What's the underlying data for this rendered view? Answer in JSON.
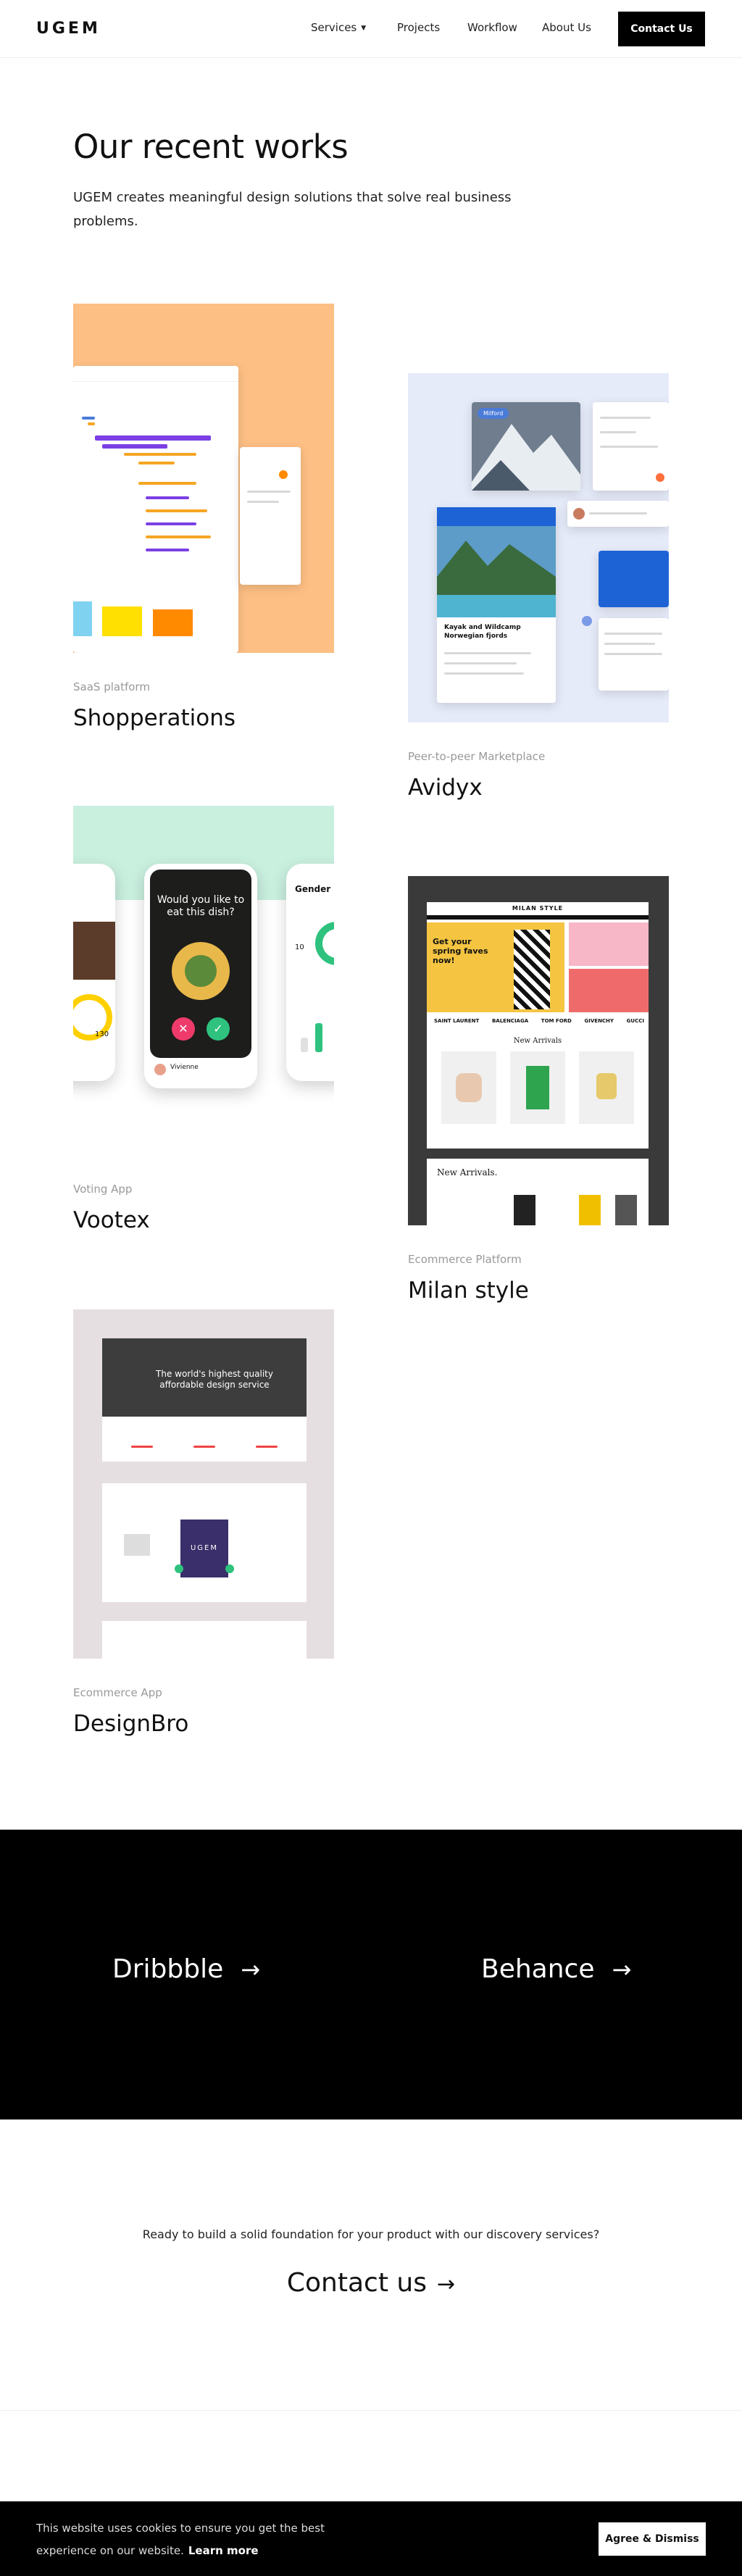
{
  "header": {
    "logo": "UGEM",
    "nav": [
      "Services",
      "Projects",
      "Workflow",
      "About Us"
    ],
    "cta": "Contact Us"
  },
  "hero": {
    "title": "Our recent works",
    "subtitle": "UGEM creates meaningful design solutions that solve real business problems."
  },
  "projects": [
    {
      "category": "SaaS platform",
      "title": "Shopperations",
      "bg": "#fdbf84"
    },
    {
      "category": "Peer-to-peer Marketplace",
      "title": "Avidyx",
      "bg": "#e6ebf9"
    },
    {
      "category": "Voting App",
      "title": "Vootex",
      "bg": "#c9efdf"
    },
    {
      "category": "Ecommerce Platform",
      "title": "Milan style",
      "bg": "#3a3a3a"
    },
    {
      "category": "Ecommerce App",
      "title": "DesignBro",
      "bg": "#e6dfe2"
    }
  ],
  "mockups": {
    "avidyx": {
      "badge": "Milford",
      "caption": "Kayak and Wildcamp Norwegian fjords"
    },
    "vootex": {
      "question": "Would you like to eat this dish?",
      "left_title": "Gender a",
      "name": "Vivienne",
      "stat": "130",
      "stat2": "10"
    },
    "milan": {
      "brand": "MILAN STYLE",
      "promo": "Get your spring faves now!",
      "arrivals": "New Arrivals",
      "arrivals2": "New Arrivals.",
      "brands": [
        "SAINT LAURENT",
        "BALENCIAGA",
        "TOM FORD",
        "GIVENCHY",
        "GUCCI"
      ]
    },
    "designbro": {
      "hero": "The world's highest quality affordable design service",
      "logo_text": "UGEM"
    }
  },
  "links": {
    "dribbble": "Dribbble",
    "behance": "Behance",
    "arrow": "→"
  },
  "contact": {
    "prompt": "Ready to build a solid foundation for your product with our discovery services?",
    "label": "Contact us"
  },
  "cookie": {
    "text": "This website uses cookies to ensure you get the best experience on our website.",
    "learn_more": "Learn more",
    "button": "Agree & Dismiss"
  },
  "colors": {
    "accent_purple": "#7b3fe4",
    "accent_orange": "#f5a623",
    "brand_black": "#000000"
  }
}
